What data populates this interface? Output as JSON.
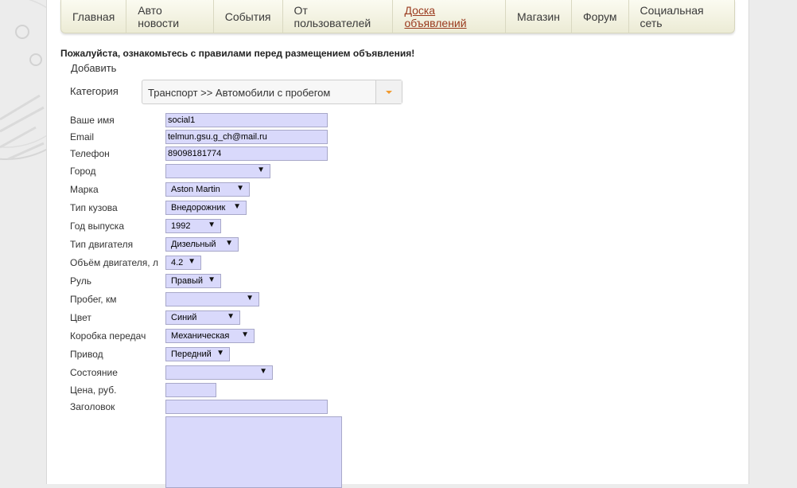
{
  "nav": {
    "items": [
      {
        "label": "Главная"
      },
      {
        "label": "Авто новости"
      },
      {
        "label": "События"
      },
      {
        "label": "От пользователей"
      },
      {
        "label": "Доска объявлений"
      },
      {
        "label": "Магазин"
      },
      {
        "label": "Форум"
      },
      {
        "label": "Социальная сеть"
      }
    ]
  },
  "notice": "Пожалуйста, ознакомьтесь с правилами перед размещением объявления!",
  "add_title": "Добавить",
  "category": {
    "label": "Категория",
    "value": "Транспорт >> Автомобили с пробегом"
  },
  "form": {
    "name": {
      "label": "Ваше имя",
      "value": "social1"
    },
    "email": {
      "label": "Email",
      "value": "telmun.gsu.g_ch@mail.ru"
    },
    "phone": {
      "label": "Телефон",
      "value": "89098181774"
    },
    "city": {
      "label": "Город",
      "value": ""
    },
    "make": {
      "label": "Марка",
      "value": "Aston Martin"
    },
    "body_type": {
      "label": "Тип кузова",
      "value": "Внедорожник"
    },
    "year": {
      "label": "Год выпуска",
      "value": "1992"
    },
    "engine_type": {
      "label": "Тип двигателя",
      "value": "Дизельный"
    },
    "engine_volume": {
      "label": "Объём двигателя, л",
      "value": "4.2"
    },
    "steering": {
      "label": "Руль",
      "value": "Правый"
    },
    "mileage": {
      "label": "Пробег, км",
      "value": ""
    },
    "color": {
      "label": "Цвет",
      "value": "Синий"
    },
    "gearbox": {
      "label": "Коробка передач",
      "value": "Механическая"
    },
    "drive": {
      "label": "Привод",
      "value": "Передний"
    },
    "condition": {
      "label": "Состояние",
      "value": ""
    },
    "price": {
      "label": "Цена, руб.",
      "value": ""
    },
    "headline": {
      "label": "Заголовок",
      "value": ""
    },
    "description": {
      "value": ""
    }
  },
  "arrow_glyph": "▼",
  "colors": {
    "field_bg": "#d9d9fb",
    "nav_active": "#9a3a1e",
    "dropdown_caret": "#f29a2e"
  }
}
